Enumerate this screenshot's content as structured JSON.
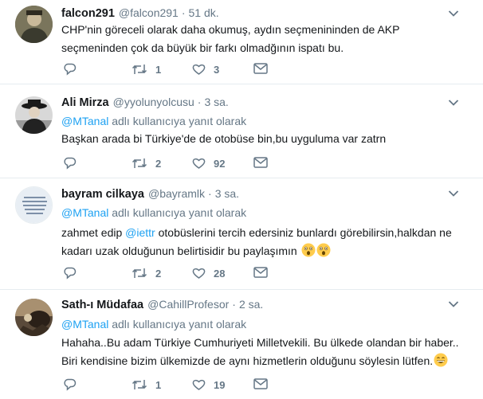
{
  "tweets": [
    {
      "name": "falcon291",
      "handle": "@falcon291",
      "sep": "·",
      "time": "51 dk.",
      "text": "CHP'nin göreceli olarak daha okumuş, aydın seçmenininden de AKP seçmeninden çok da büyük bir farkı olmadğının ispatı bu.",
      "retweets": "1",
      "likes": "3"
    },
    {
      "name": "Ali Mirza",
      "handle": "@yyolunyolcusu",
      "sep": "·",
      "time": "3 sa.",
      "reply_mention": "@MTanal",
      "reply_suffix": "adlı kullanıcıya yanıt olarak",
      "text": "Başkan arada bi Türkiye'de de otobüse bin,bu uyguluma var zatrn",
      "retweets": "2",
      "likes": "92"
    },
    {
      "name": "bayram cilkaya",
      "handle": "@bayramlk",
      "sep": "·",
      "time": "3 sa.",
      "reply_mention": "@MTanal",
      "reply_suffix": "adlı kullanıcıya yanıt olarak",
      "text_pre": "zahmet edip",
      "text_mention": "@iettr",
      "text_post": "otobüslerini tercih edersiniz bunlardı görebilirsin,halkdan ne kadarı uzak olduğunun belirtisidir bu paylaşımın",
      "retweets": "2",
      "likes": "28"
    },
    {
      "name": "Sath-ı Müdafaa",
      "handle": "@CahillProfesor",
      "sep": "·",
      "time": "2 sa.",
      "reply_mention": "@MTanal",
      "reply_suffix": "adlı kullanıcıya yanıt olarak",
      "text_line1": "Hahaha..Bu adam Türkiye Cumhuriyeti Milletvekili. Bu ülkede olandan bir haber..",
      "text_line2": "Biri kendisine bizim ülkemizde de aynı hizmetlerin olduğunu söylesin lütfen.",
      "retweets": "1",
      "likes": "19"
    }
  ],
  "colors": {
    "accent": "#1da1f2",
    "secondary_text": "#657786",
    "divider": "#e6ecf0"
  },
  "icons": [
    "reply-icon",
    "retweet-icon",
    "like-icon",
    "direct-message-icon",
    "chevron-down-icon"
  ]
}
